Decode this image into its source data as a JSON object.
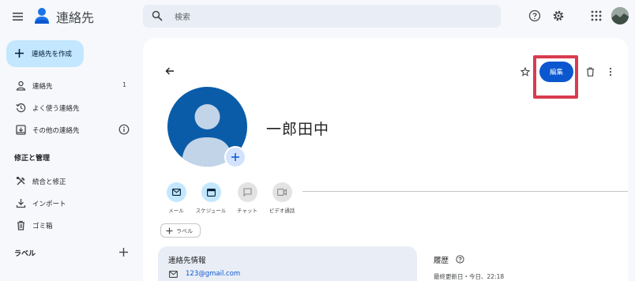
{
  "header": {
    "app_title": "連絡先",
    "search_placeholder": "検索"
  },
  "sidebar": {
    "create_label": "連絡先を作成",
    "items": [
      {
        "label": "連絡先",
        "count": "1",
        "icon": "person-icon"
      },
      {
        "label": "よく使う連絡先",
        "icon": "history-icon"
      },
      {
        "label": "その他の連絡先",
        "icon": "inbox-download-icon"
      }
    ],
    "manage_heading": "修正と管理",
    "manage_items": [
      {
        "label": "統合と修正",
        "icon": "tools-icon"
      },
      {
        "label": "インポート",
        "icon": "download-icon"
      },
      {
        "label": "ゴミ箱",
        "icon": "trash-icon"
      }
    ],
    "labels_heading": "ラベル"
  },
  "contact": {
    "name": "一郎田中",
    "edit_label": "編集",
    "actions": [
      {
        "label": "メール",
        "icon": "mail-icon",
        "enabled": true
      },
      {
        "label": "スケジュール",
        "icon": "calendar-icon",
        "enabled": true
      },
      {
        "label": "チャット",
        "icon": "chat-icon",
        "enabled": false
      },
      {
        "label": "ビデオ通話",
        "icon": "video-icon",
        "enabled": false
      }
    ],
    "label_chip": "ラベル",
    "info_title": "連絡先情報",
    "email": "123@gmail.com",
    "history_title": "履歴",
    "history_updated": "最終更新日・今日、22:18"
  },
  "colors": {
    "accent": "#0b57d0",
    "highlight": "#d93b4f",
    "create_button_bg": "#c2e7ff",
    "avatar_bg": "#0b5ca8"
  }
}
